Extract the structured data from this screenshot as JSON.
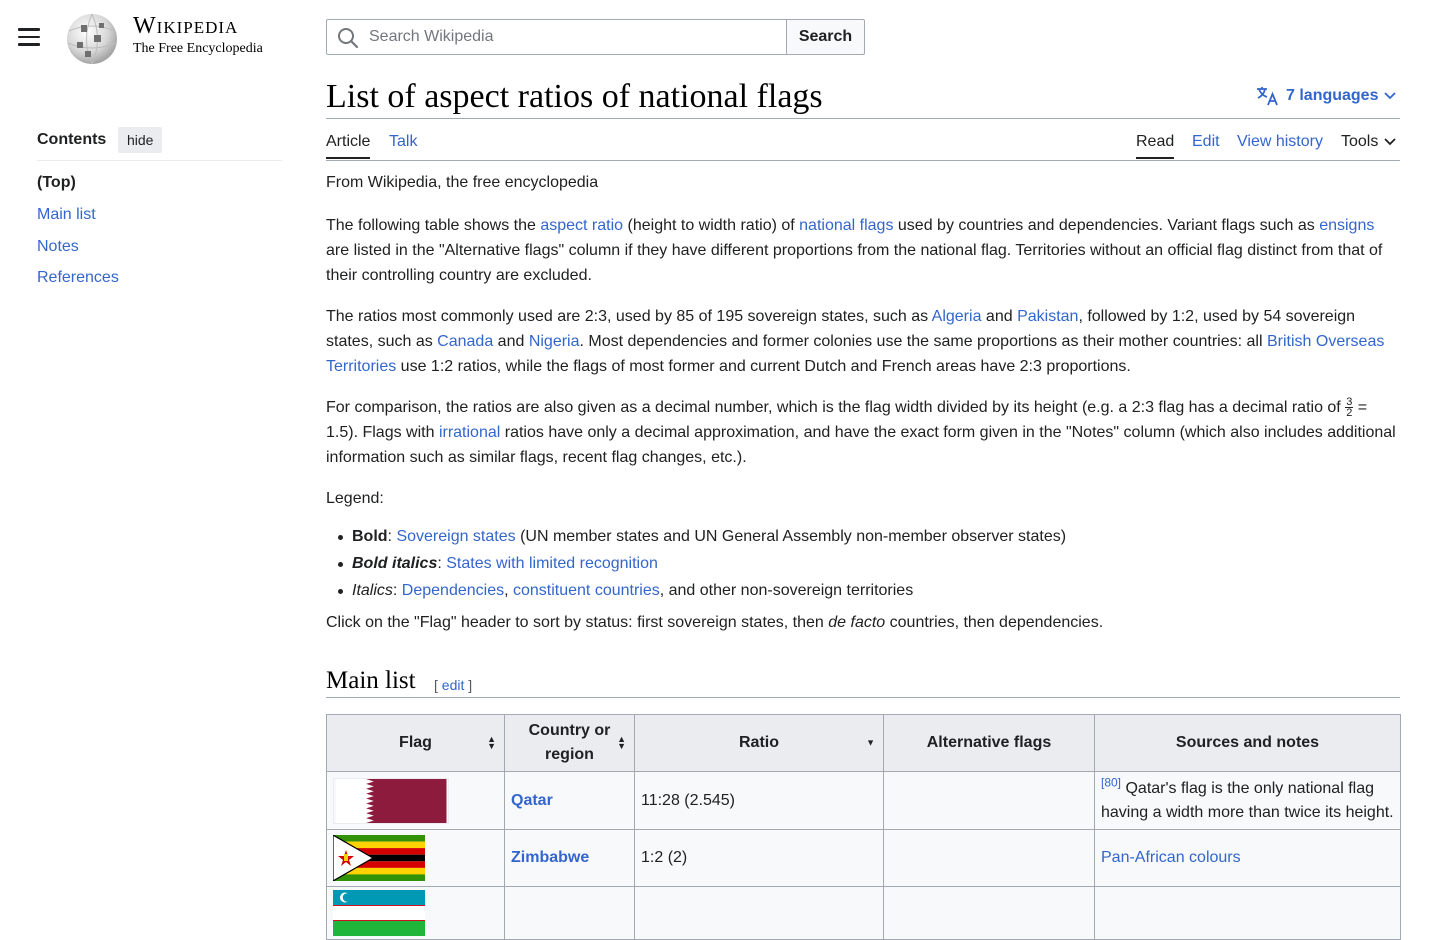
{
  "header": {
    "wordmark": "Wikipedia",
    "tagline": "The Free Encyclopedia",
    "search_placeholder": "Search Wikipedia",
    "search_button": "Search"
  },
  "toc": {
    "title": "Contents",
    "hide": "hide",
    "items": [
      "(Top)",
      "Main list",
      "Notes",
      "References"
    ]
  },
  "page": {
    "title": "List of aspect ratios of national flags",
    "languages": "7 languages",
    "tabs": {
      "article": "Article",
      "talk": "Talk",
      "read": "Read",
      "edit": "Edit",
      "history": "View history",
      "tools": "Tools"
    },
    "from": "From Wikipedia, the free encyclopedia"
  },
  "p1": {
    "t1": "The following table shows the ",
    "l1": "aspect ratio",
    "t2": " (height to width ratio) of ",
    "l2": "national flags",
    "t3": " used by countries and dependencies. Variant flags such as ",
    "l3": "ensigns",
    "t4": " are listed in the \"Alternative flags\" column if they have different proportions from the national flag. Territories without an official flag distinct from that of their controlling country are excluded."
  },
  "p2": {
    "t1": "The ratios most commonly used are 2:3, used by 85 of 195 sovereign states, such as ",
    "l1": "Algeria",
    "t2": " and ",
    "l2": "Pakistan",
    "t3": ", followed by 1:2, used by 54 sovereign states, such as ",
    "l3": "Canada",
    "t4": " and ",
    "l4": "Nigeria",
    "t5": ". Most dependencies and former colonies use the same proportions as their mother countries: all ",
    "l5": "British Overseas Territories",
    "t6": " use 1:2 ratios, while the flags of most former and current Dutch and French areas have 2:3 proportions."
  },
  "p3": {
    "t1": "For comparison, the ratios are also given as a decimal number, which is the flag width divided by its height (e.g. a 2:3 flag has a decimal ratio of ",
    "frac_num": "3",
    "frac_den": "2",
    "t2": " = 1.5). Flags with ",
    "l1": "irrational",
    "t3": " ratios have only a decimal approximation, and have the exact form given in the \"Notes\" column (which also includes additional information such as similar flags, recent flag changes, etc.)."
  },
  "legend": {
    "title": "Legend:",
    "b_label": "Bold",
    "b_link": "Sovereign states",
    "b_rest": " (UN member states and UN General Assembly non-member observer states)",
    "bi_label": "Bold italics",
    "bi_link": "States with limited recognition",
    "i_label": "Italics",
    "i_link1": "Dependencies",
    "i_link2": "constituent countries",
    "i_rest": ", and other non-sovereign territories",
    "colon": ": ",
    "comma": ", "
  },
  "sort_note": {
    "t1": "Click on the \"Flag\" header to sort by status: first sovereign states, then ",
    "em": "de facto",
    "t2": " countries, then dependencies."
  },
  "main_list": {
    "heading": "Main list",
    "edit_open": "[ ",
    "edit": "edit",
    "edit_close": " ]"
  },
  "table": {
    "headers": {
      "flag": "Flag",
      "country": "Country or region",
      "ratio": "Ratio",
      "alt": "Alternative flags",
      "notes": "Sources and notes"
    },
    "rows": [
      {
        "country": "Qatar",
        "ratio": "11:28 (2.545)",
        "ref": "[80]",
        "note": "Qatar's flag is the only national flag having a width more than twice its height."
      },
      {
        "country": "Zimbabwe",
        "ratio": "1:2 (2)",
        "note_link": "Pan-African colours"
      }
    ]
  },
  "colors": {
    "link": "#3366cc",
    "qatar_maroon": "#8d1b3d"
  }
}
